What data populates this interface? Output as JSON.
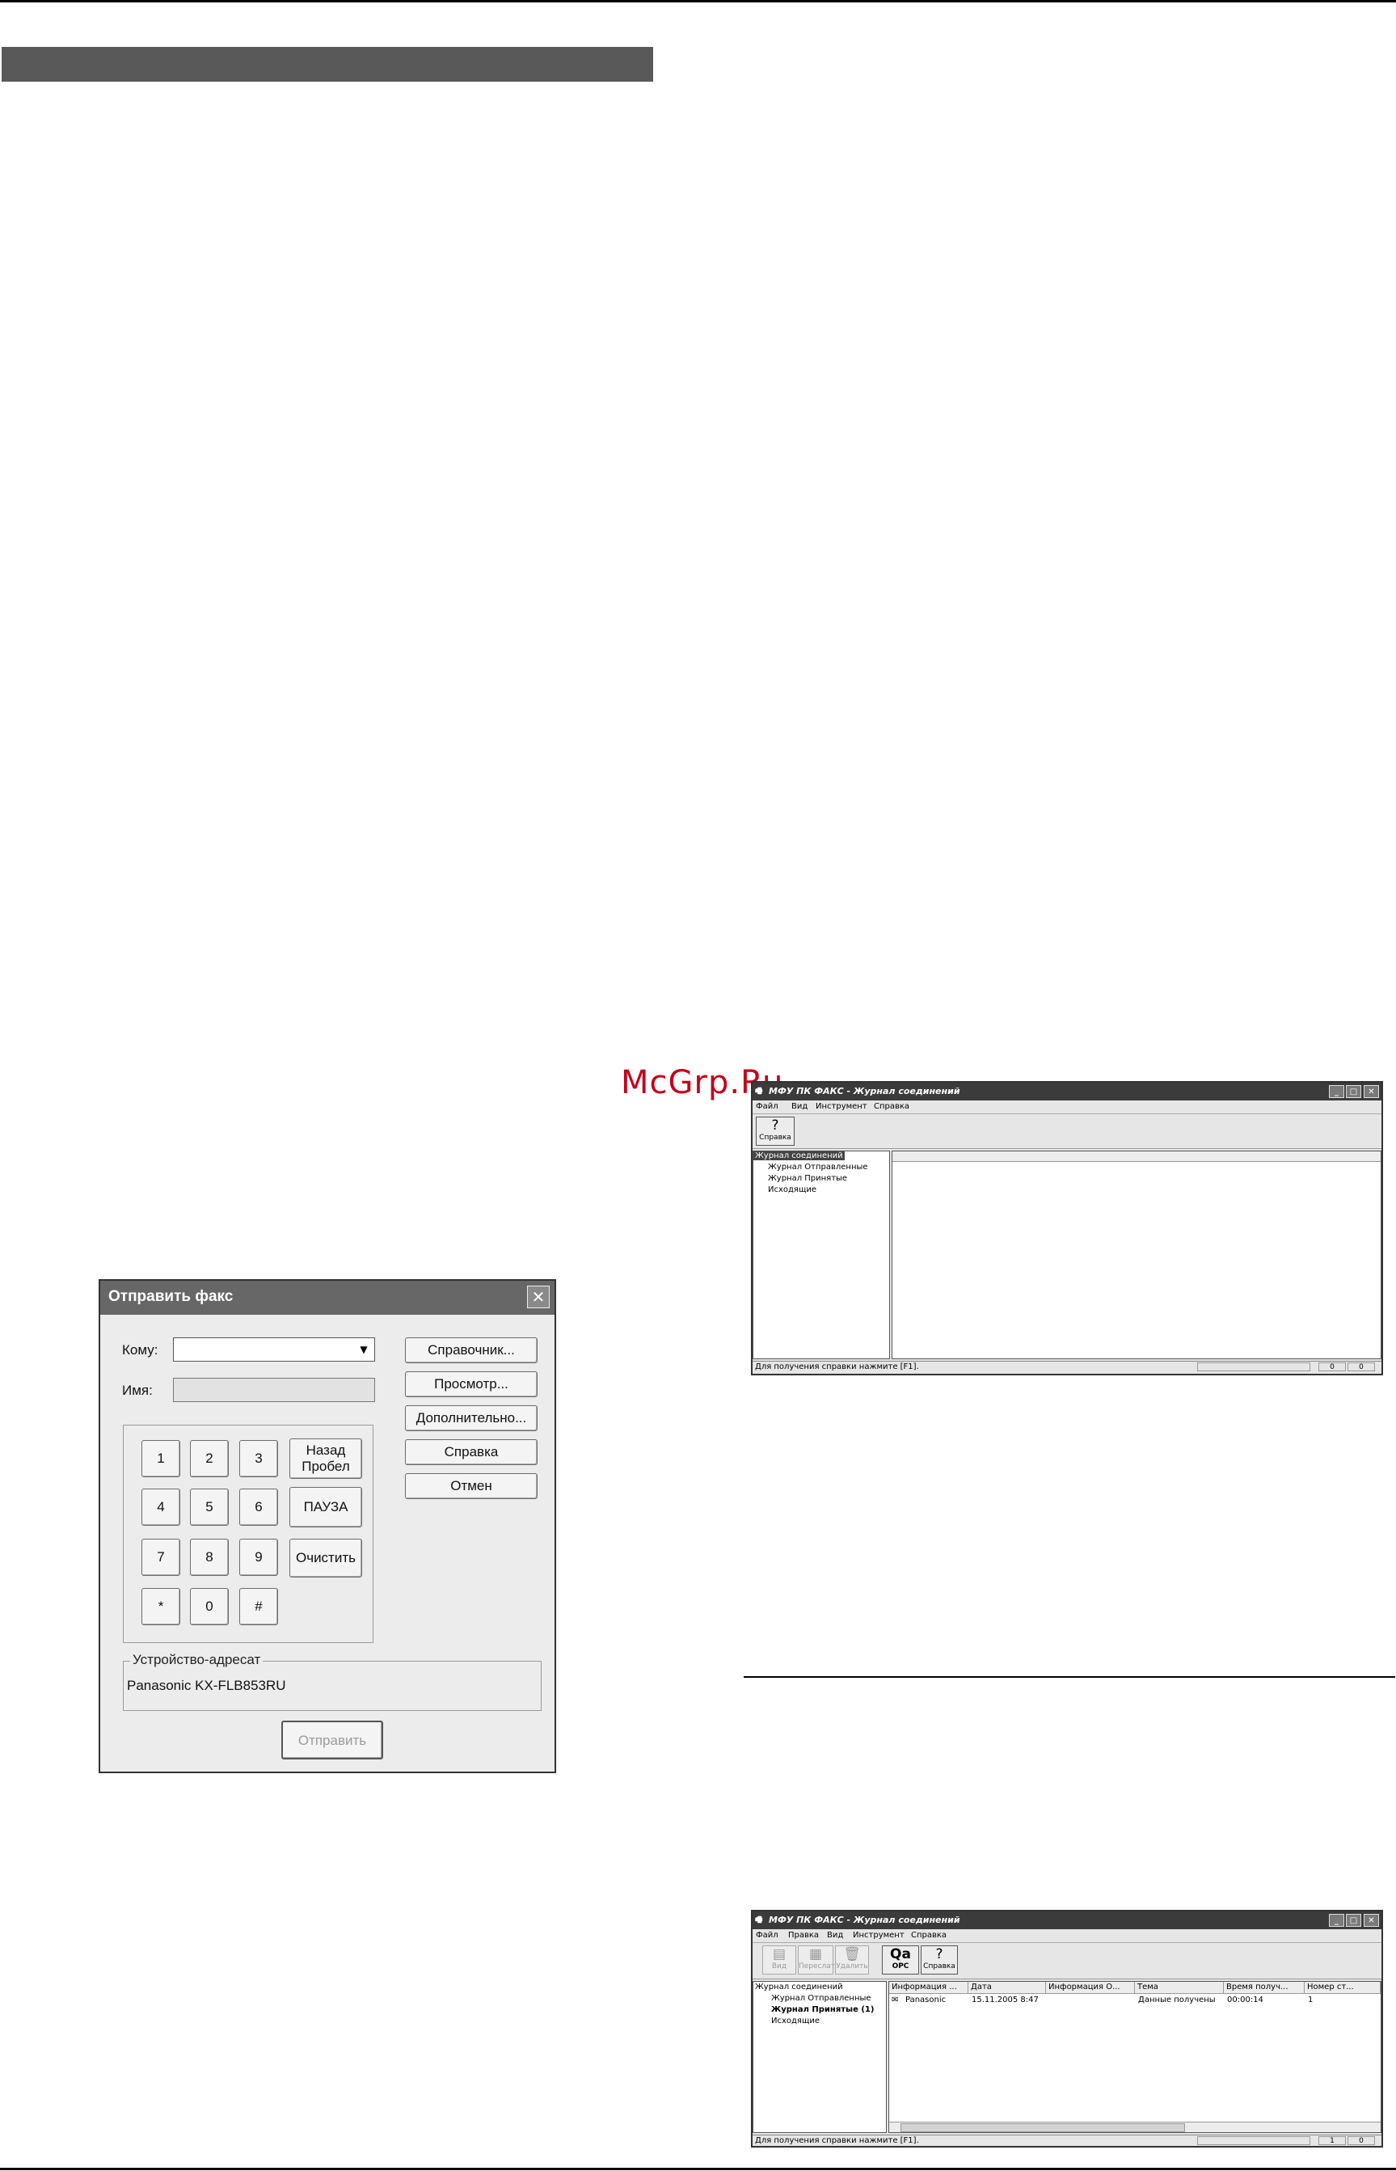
{
  "watermark": "McGrp.Ru",
  "send_fax_dialog": {
    "title": "Отправить факс",
    "to_label": "Кому:",
    "name_label": "Имя:",
    "to_value": "",
    "name_value": "",
    "side_buttons": [
      "Справочник...",
      "Просмотр...",
      "Дополнительно...",
      "Справка",
      "Отмен"
    ],
    "keys": [
      "1",
      "2",
      "3",
      "4",
      "5",
      "6",
      "7",
      "8",
      "9",
      "*",
      "0",
      "#"
    ],
    "back_label_1": "Назад",
    "back_label_2": "Пробел",
    "pause_label": "ПАУЗА",
    "clear_label": "Очистить",
    "dest_group_label": "Устройство-адресат",
    "dest_value": "Panasonic KX-FLB853RU",
    "send_label": "Отправить"
  },
  "journal_window_1": {
    "title": "МФУ ПК ФАКС - Журнал соединений",
    "menu": [
      "Файл",
      "Вид",
      "Инструмент",
      "Справка"
    ],
    "toolbar": [
      "Справка"
    ],
    "tree": [
      "Журнал соединений",
      "Журнал Отправленные",
      "Журнал Принятые",
      "Исходящие"
    ],
    "status_text": "Для получения справки нажмите [F1].",
    "status_cells": [
      "0",
      "0"
    ]
  },
  "journal_window_2": {
    "title": "МФУ ПК ФАКС - Журнал соединений",
    "menu": [
      "Файл",
      "Правка",
      "Вид",
      "Инструмент",
      "Справка"
    ],
    "toolbar": [
      "Вид",
      "Переслать",
      "Удалить",
      "OPC",
      "Справка"
    ],
    "tree": [
      "Журнал соединений",
      "Журнал Отправленные",
      "Журнал Принятые (1)",
      "Исходящие"
    ],
    "columns": [
      "Информация ...",
      "Дата",
      "Информация О...",
      "Тема",
      "Время получ...",
      "Номер ст..."
    ],
    "row": [
      "Panasonic",
      "15.11.2005 8:47",
      "",
      "Данные получены",
      "00:00:14",
      "1"
    ],
    "status_text": "Для получения справки нажмите [F1].",
    "status_cells": [
      "1",
      "0"
    ]
  }
}
